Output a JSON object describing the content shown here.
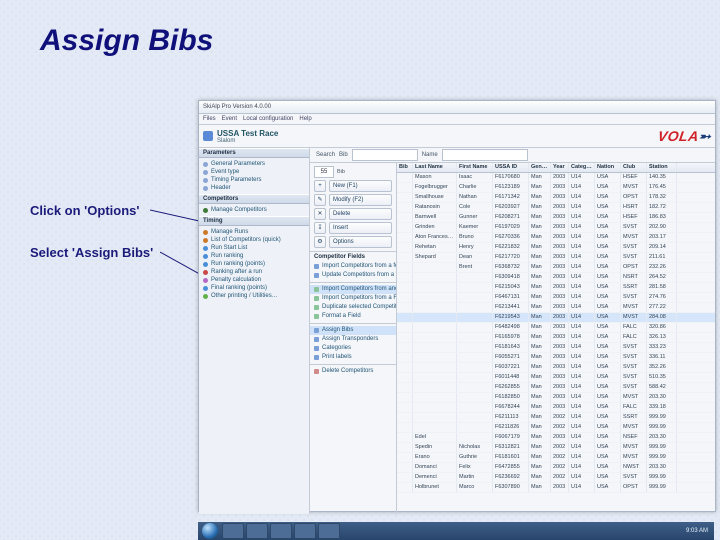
{
  "page": {
    "title": "Assign Bibs",
    "instructions": {
      "options": "Click on 'Options'",
      "assign": "Select 'Assign Bibs'"
    }
  },
  "app": {
    "titlebar": "SkiAlp Pro Version 4.0.00",
    "menu": [
      "Files",
      "Event",
      "Local configuration",
      "Help"
    ],
    "header_name": "USSA Test Race",
    "header_sub": "Slalom",
    "logo": "VOLA",
    "search": {
      "label": "Search",
      "bib_label": "Bib",
      "name_label": "Name"
    }
  },
  "side": {
    "parameters": {
      "title": "Parameters",
      "items": [
        {
          "label": "General Parameters",
          "color": "#8aa5d6"
        },
        {
          "label": "Event type",
          "color": "#8aa5d6"
        },
        {
          "label": "Timing Parameters",
          "color": "#8aa5d6"
        },
        {
          "label": "Header",
          "color": "#8aa5d6"
        }
      ]
    },
    "competitors": {
      "title": "Competitors",
      "items": [
        {
          "label": "Manage Competitors",
          "color": "#3f7a38"
        }
      ]
    },
    "timing": {
      "title": "Timing",
      "items": [
        {
          "label": "Manage Runs",
          "color": "#cc7a2a"
        },
        {
          "label": "List of Competitors (quick)",
          "color": "#cc7a2a"
        },
        {
          "label": "Run Start List",
          "color": "#4a90d9"
        },
        {
          "label": "Run ranking",
          "color": "#4a90d9"
        },
        {
          "label": "Run ranking (points)",
          "color": "#4a90d9"
        },
        {
          "label": "Ranking after a run",
          "color": "#c94848"
        },
        {
          "label": "Penalty calculation",
          "color": "#b468c6"
        },
        {
          "label": "Final ranking (points)",
          "color": "#4a90d9"
        },
        {
          "label": "Other printing / Utilities…",
          "color": "#64b04a"
        }
      ]
    }
  },
  "midtop": {
    "count": "55",
    "new": "New (F1)",
    "modify": "Modify (F2)",
    "delete": "Delete",
    "insert": "Insert",
    "options": "Options"
  },
  "cf": {
    "title": "Competitor Fields",
    "group1": [
      "Import Competitors from a federation file",
      "Update Competitors from a federation file"
    ],
    "group2": [
      "Import Competitors from another event",
      "Import Competitors from a File",
      "Duplicate selected Competitor",
      "Format a Field"
    ],
    "group3": [
      "Assign Bibs",
      "Assign Transponders",
      "Categories",
      "Print labels"
    ],
    "footer": "Delete Competitors"
  },
  "grid": {
    "cols": [
      "Bib",
      "Last Name",
      "First Name",
      "USSA ID",
      "Gender",
      "Year",
      "Category",
      "Nation",
      "Club",
      "Station"
    ],
    "rows": [
      [
        "",
        "Mason",
        "Isaac",
        "F6170680",
        "Man",
        "2003",
        "U14",
        "USA",
        "HSEF",
        "140.35"
      ],
      [
        "",
        "Fogelbrugger",
        "Charlie",
        "F6123189",
        "Man",
        "2003",
        "U14",
        "USA",
        "MVST",
        "176.45"
      ],
      [
        "",
        "Smallhouse",
        "Nathan",
        "F6171342",
        "Man",
        "2003",
        "U14",
        "USA",
        "OPST",
        "178.32"
      ],
      [
        "",
        "Ratanosin",
        "Cole",
        "F6203927",
        "Man",
        "2003",
        "U14",
        "USA",
        "HSRT",
        "182.72"
      ],
      [
        "",
        "Barnwell",
        "Gunner",
        "F6208271",
        "Man",
        "2003",
        "U14",
        "USA",
        "HSEF",
        "186.83"
      ],
      [
        "",
        "Grinden",
        "Kaemer",
        "F6197029",
        "Man",
        "2003",
        "U14",
        "USA",
        "SVST",
        "202.90"
      ],
      [
        "",
        "Aton Franceschi",
        "Bruno",
        "F6270336",
        "Man",
        "2003",
        "U14",
        "USA",
        "MVST",
        "203.17"
      ],
      [
        "",
        "Rehetan",
        "Henry",
        "F6221832",
        "Man",
        "2003",
        "U14",
        "USA",
        "SVST",
        "209.14"
      ],
      [
        "",
        "Shepard",
        "Dean",
        "F6217720",
        "Man",
        "2003",
        "U14",
        "USA",
        "SVST",
        "211.61"
      ],
      [
        "",
        "",
        "Brent",
        "F6368732",
        "Man",
        "2003",
        "U14",
        "USA",
        "OPST",
        "232.26"
      ],
      [
        "",
        "",
        "",
        "F6309418",
        "Man",
        "2003",
        "U14",
        "USA",
        "NSRT",
        "264.52"
      ],
      [
        "",
        "",
        "",
        "F6215043",
        "Man",
        "2003",
        "U14",
        "USA",
        "SSRT",
        "281.58"
      ],
      [
        "",
        "",
        "",
        "F6467131",
        "Man",
        "2003",
        "U14",
        "USA",
        "SVST",
        "274.76"
      ],
      [
        "",
        "",
        "",
        "F6213441",
        "Man",
        "2003",
        "U14",
        "USA",
        "MVST",
        "277.22"
      ],
      [
        "",
        "",
        "",
        "F6219543",
        "Man",
        "2003",
        "U14",
        "USA",
        "MVST",
        "284.08"
      ],
      [
        "",
        "",
        "",
        "F6482498",
        "Man",
        "2003",
        "U14",
        "USA",
        "FALC",
        "320.86"
      ],
      [
        "",
        "",
        "",
        "F6165978",
        "Man",
        "2003",
        "U14",
        "USA",
        "FALC",
        "326.13"
      ],
      [
        "",
        "",
        "",
        "F6181643",
        "Man",
        "2003",
        "U14",
        "USA",
        "SVST",
        "333.23"
      ],
      [
        "",
        "",
        "",
        "F6055271",
        "Man",
        "2003",
        "U14",
        "USA",
        "SVST",
        "336.11"
      ],
      [
        "",
        "",
        "",
        "F6037221",
        "Man",
        "2003",
        "U14",
        "USA",
        "SVST",
        "352.26"
      ],
      [
        "",
        "",
        "",
        "F6011448",
        "Man",
        "2003",
        "U14",
        "USA",
        "SVST",
        "510.35"
      ],
      [
        "",
        "",
        "",
        "F6262855",
        "Man",
        "2003",
        "U14",
        "USA",
        "SVST",
        "588.42"
      ],
      [
        "",
        "",
        "",
        "F6182850",
        "Man",
        "2003",
        "U14",
        "USA",
        "MVST",
        "203.30"
      ],
      [
        "",
        "",
        "",
        "F6678244",
        "Man",
        "2003",
        "U14",
        "USA",
        "FALC",
        "339.18"
      ],
      [
        "",
        "",
        "",
        "F6211113",
        "Man",
        "2002",
        "U14",
        "USA",
        "SSRT",
        "999.99"
      ],
      [
        "",
        "",
        "",
        "F6211826",
        "Man",
        "2002",
        "U14",
        "USA",
        "MVST",
        "999.99"
      ],
      [
        "",
        "Edel",
        "",
        "F6067179",
        "Man",
        "2003",
        "U14",
        "USA",
        "NSEF",
        "203.30"
      ],
      [
        "",
        "Spedin",
        "Nicholas",
        "F6312821",
        "Man",
        "2002",
        "U14",
        "USA",
        "MVST",
        "999.99"
      ],
      [
        "",
        "Erano",
        "Guthrie",
        "F6181601",
        "Man",
        "2002",
        "U14",
        "USA",
        "MVST",
        "999.99"
      ],
      [
        "",
        "Domanci",
        "Felix",
        "F6472855",
        "Man",
        "2002",
        "U14",
        "USA",
        "NWST",
        "203.30"
      ],
      [
        "",
        "Demenci",
        "Martin",
        "F6236692",
        "Man",
        "2002",
        "U14",
        "USA",
        "SVST",
        "999.99"
      ],
      [
        "",
        "Holbrunet",
        "Marco",
        "F6307890",
        "Man",
        "2003",
        "U14",
        "USA",
        "OPST",
        "999.99"
      ]
    ],
    "hi_row": 14
  },
  "taskbar": {
    "clock": "9:03 AM"
  }
}
